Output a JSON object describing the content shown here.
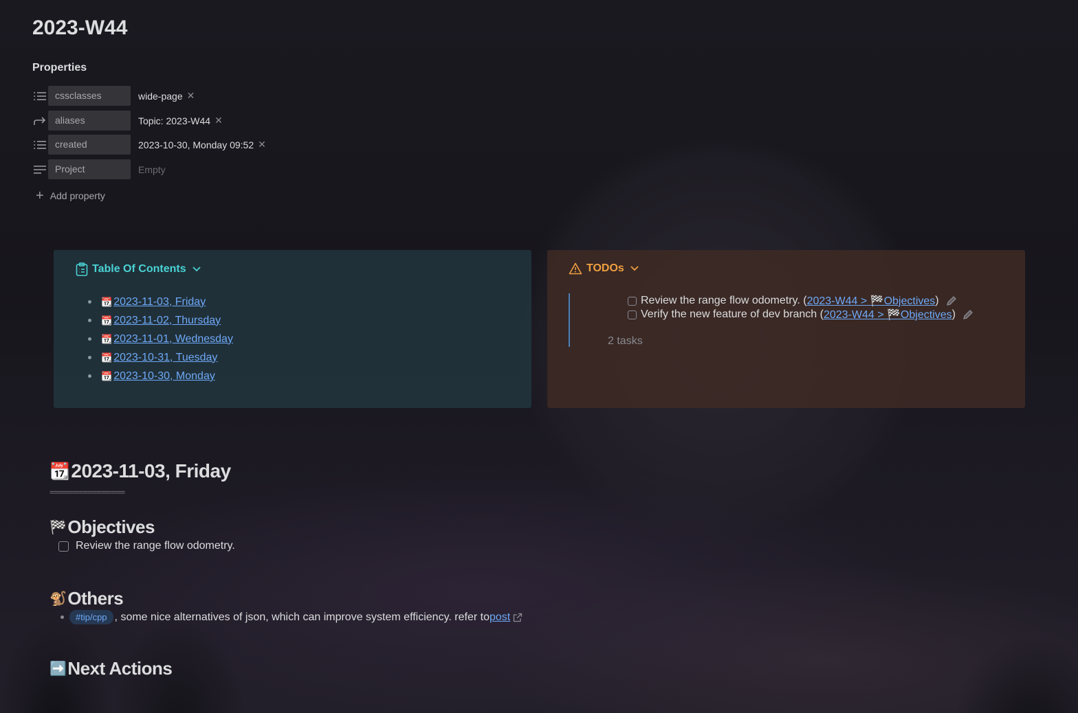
{
  "page": {
    "title": "2023-W44"
  },
  "properties": {
    "heading": "Properties",
    "rows": [
      {
        "icon": "list-icon",
        "key": "cssclasses",
        "value": "wide-page",
        "removable": true
      },
      {
        "icon": "arrow-forward-icon",
        "key": "aliases",
        "value": "Topic: 2023-W44",
        "removable": true
      },
      {
        "icon": "list-icon",
        "key": "created",
        "value": "2023-10-30, Monday 09:52",
        "removable": true
      },
      {
        "icon": "text-lines-icon",
        "key": "Project",
        "value": "Empty",
        "removable": false
      }
    ],
    "add_label": "Add property"
  },
  "toc": {
    "title": "Table Of Contents",
    "items": [
      "2023-11-03, Friday",
      "2023-11-02, Thursday",
      "2023-11-01, Wednesday",
      "2023-10-31, Tuesday",
      "2023-10-30, Monday"
    ],
    "accent": "#4ad3d3"
  },
  "todos": {
    "title": "TODOs",
    "accent": "#f0a040",
    "items": [
      {
        "text": "Review the range flow odometry.",
        "link": "2023-W44 > 🏁Objectives"
      },
      {
        "text": "Verify the new feature of dev branch",
        "link": "2023-W44 > 🏁Objectives"
      }
    ],
    "count": "2 tasks"
  },
  "sections": {
    "day_heading": {
      "emoji": "📆",
      "text": "2023-11-03, Friday"
    },
    "rule": "================",
    "objectives": {
      "emoji": "🏁",
      "heading": "Objectives",
      "task": "Review the range flow odometry."
    },
    "others": {
      "emoji": "🐒",
      "heading": "Others",
      "tag": "#tip/cpp",
      "text": ", some nice alternatives of json, which can improve system efficiency. refer to",
      "link": "post"
    },
    "next_actions": {
      "emoji": "➡️",
      "heading": "Next Actions"
    }
  },
  "colors": {
    "link": "#6ea9f7",
    "text": "#dcddde",
    "muted": "#8a8a90"
  }
}
